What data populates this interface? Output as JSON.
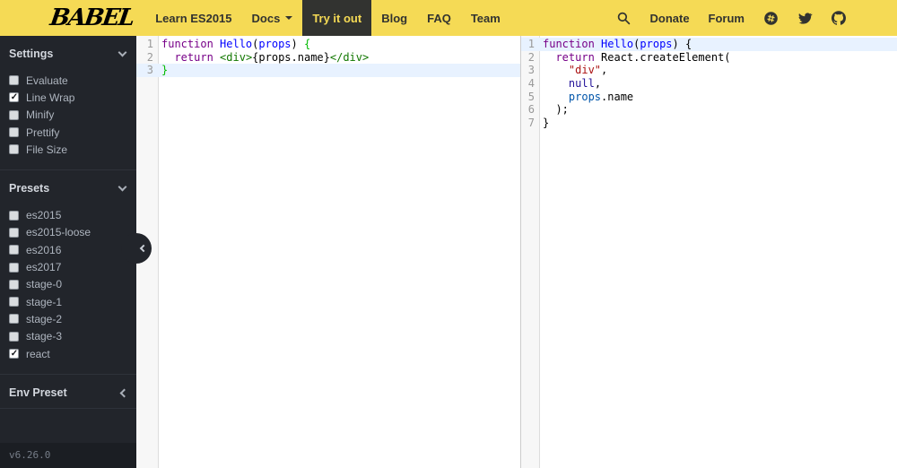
{
  "navbar": {
    "logo_text": "BABEL",
    "items": [
      {
        "label": "Learn ES2015",
        "active": false,
        "caret": false
      },
      {
        "label": "Docs",
        "active": false,
        "caret": true
      },
      {
        "label": "Try it out",
        "active": true,
        "caret": false
      },
      {
        "label": "Blog",
        "active": false,
        "caret": false
      },
      {
        "label": "FAQ",
        "active": false,
        "caret": false
      },
      {
        "label": "Team",
        "active": false,
        "caret": false
      }
    ],
    "links_right": [
      {
        "label": "Donate"
      },
      {
        "label": "Forum"
      }
    ],
    "icons_right": [
      "search-icon",
      "slack-icon",
      "twitter-icon",
      "github-icon"
    ],
    "colors": {
      "bg": "#f5da55",
      "active_bg": "#323330",
      "text": "#323330"
    }
  },
  "sidebar": {
    "sections": [
      {
        "title": "Settings",
        "chevron": "down",
        "items": [
          {
            "label": "Evaluate",
            "checked": false
          },
          {
            "label": "Line Wrap",
            "checked": true
          },
          {
            "label": "Minify",
            "checked": false
          },
          {
            "label": "Prettify",
            "checked": false
          },
          {
            "label": "File Size",
            "checked": false
          }
        ]
      },
      {
        "title": "Presets",
        "chevron": "down",
        "items": [
          {
            "label": "es2015",
            "checked": false
          },
          {
            "label": "es2015-loose",
            "checked": false
          },
          {
            "label": "es2016",
            "checked": false
          },
          {
            "label": "es2017",
            "checked": false
          },
          {
            "label": "stage-0",
            "checked": false
          },
          {
            "label": "stage-1",
            "checked": false
          },
          {
            "label": "stage-2",
            "checked": false
          },
          {
            "label": "stage-3",
            "checked": false
          },
          {
            "label": "react",
            "checked": true
          }
        ]
      },
      {
        "title": "Env Preset",
        "chevron": "left",
        "items": []
      }
    ],
    "version": "v6.26.0",
    "colors": {
      "bg": "#22252b",
      "version_bg": "#1b1e23"
    }
  },
  "editors": {
    "input": {
      "active_line": 3,
      "lines": [
        [
          {
            "t": "function",
            "c": "kw"
          },
          {
            "t": " ",
            "c": ""
          },
          {
            "t": "Hello",
            "c": "def"
          },
          {
            "t": "(",
            "c": ""
          },
          {
            "t": "props",
            "c": "def"
          },
          {
            "t": ") ",
            "c": ""
          },
          {
            "t": "{",
            "c": "mb"
          }
        ],
        [
          {
            "t": "  ",
            "c": ""
          },
          {
            "t": "return",
            "c": "kw"
          },
          {
            "t": " ",
            "c": ""
          },
          {
            "t": "<div>",
            "c": "tag"
          },
          {
            "t": "{props.name}",
            "c": ""
          },
          {
            "t": "</div>",
            "c": "tag"
          }
        ],
        [
          {
            "t": "}",
            "c": "mb"
          }
        ]
      ]
    },
    "output": {
      "active_line": 1,
      "lines": [
        [
          {
            "t": "function",
            "c": "kw"
          },
          {
            "t": " ",
            "c": ""
          },
          {
            "t": "Hello",
            "c": "def"
          },
          {
            "t": "(",
            "c": ""
          },
          {
            "t": "props",
            "c": "def"
          },
          {
            "t": ") {",
            "c": ""
          }
        ],
        [
          {
            "t": "  ",
            "c": ""
          },
          {
            "t": "return",
            "c": "kw"
          },
          {
            "t": " React.createElement(",
            "c": ""
          }
        ],
        [
          {
            "t": "    ",
            "c": ""
          },
          {
            "t": "\"div\"",
            "c": "str"
          },
          {
            "t": ",",
            "c": ""
          }
        ],
        [
          {
            "t": "    ",
            "c": ""
          },
          {
            "t": "null",
            "c": "atom"
          },
          {
            "t": ",",
            "c": ""
          }
        ],
        [
          {
            "t": "    ",
            "c": ""
          },
          {
            "t": "props",
            "c": "v2"
          },
          {
            "t": ".name",
            "c": ""
          }
        ],
        [
          {
            "t": "  );",
            "c": ""
          }
        ],
        [
          {
            "t": "}",
            "c": ""
          }
        ]
      ]
    },
    "colors": {
      "active_line_bg": "#e8f2ff",
      "gutter_bg": "#f7f7f7",
      "gutter_border": "#ddd",
      "line_number": "#999"
    }
  }
}
